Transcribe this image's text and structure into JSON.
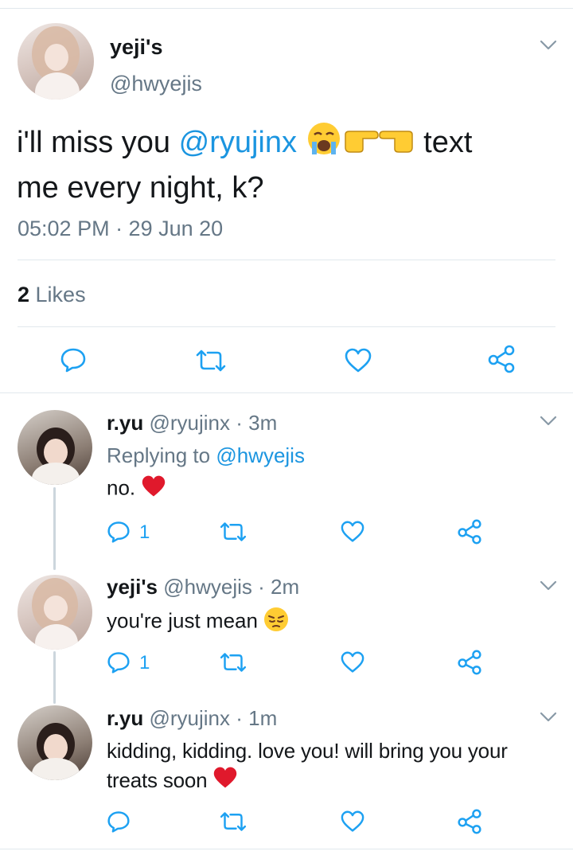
{
  "main_tweet": {
    "display_name": "yeji's",
    "handle": "@hwyejis",
    "text_before": "i'll miss you ",
    "mention": "@ryujinx",
    "text_after_emoji": " text",
    "text_line2": "me every night, k?",
    "emojis": [
      "loudly-crying-face",
      "backhand-index-pointing-right",
      "backhand-index-pointing-left"
    ],
    "timestamp": "05:02 PM · 29 Jun 20",
    "likes_count": "2",
    "likes_label": " Likes"
  },
  "replies": [
    {
      "display_name": "r.yu",
      "handle": "@ryujinx",
      "time": " · 3m",
      "replying_label": "Replying to ",
      "replying_handle": "@hwyejis",
      "text": "no. ",
      "emoji": "red-heart",
      "reply_count": "1"
    },
    {
      "display_name": "yeji's",
      "handle": "@hwyejis",
      "time": " · 2m",
      "text": "you're just mean ",
      "emoji": "pensive-face",
      "reply_count": "1"
    },
    {
      "display_name": "r.yu",
      "handle": "@ryujinx",
      "time": " · 1m",
      "text_line1": "kidding, kidding. love you! will bring you your",
      "text_line2": "treats soon ",
      "emoji": "red-heart",
      "reply_count": ""
    }
  ],
  "colors": {
    "link": "#1b95e0",
    "secondary_text": "#657786",
    "icon": "#1da1f2",
    "divider": "#e1e8ed",
    "heart_emoji": "#e0192c"
  }
}
